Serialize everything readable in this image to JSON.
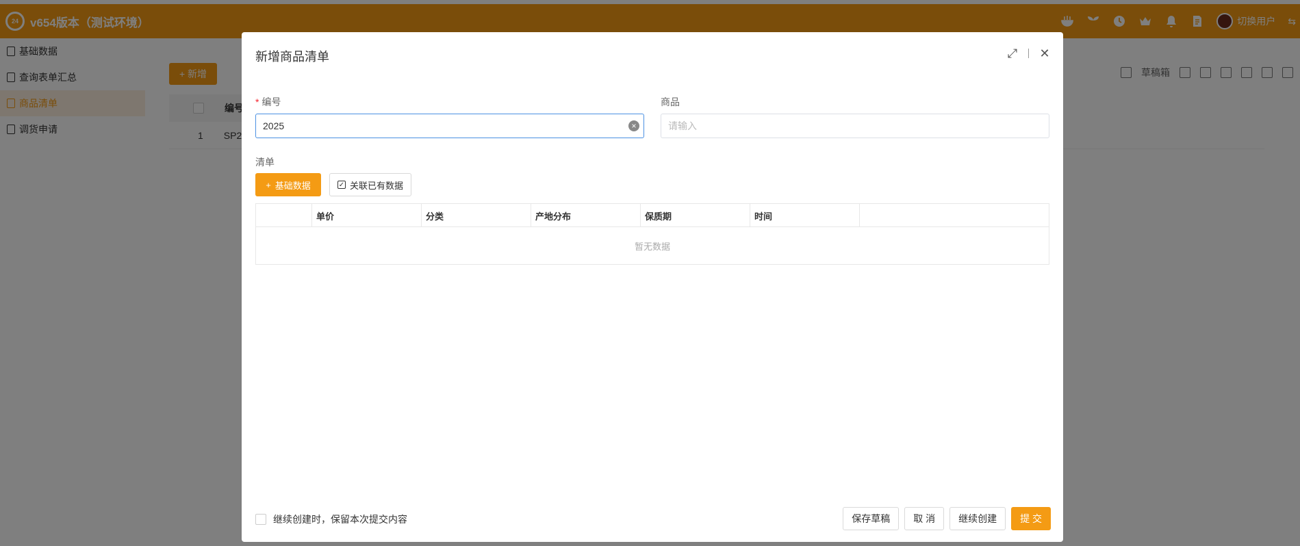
{
  "app": {
    "title": "v654版本（测试环境）",
    "logo_text": "24",
    "user_name": "切换用户",
    "arrow": "⇆"
  },
  "colors": {
    "accent": "#f49b14",
    "danger": "#f5222d",
    "focus": "#4a90e2"
  },
  "top_icons": [
    "noodle-icon",
    "sprout-icon",
    "clock-icon",
    "crown-icon",
    "bell-icon",
    "document-icon"
  ],
  "sidebar": {
    "items": [
      {
        "label": "基础数据",
        "active": false
      },
      {
        "label": "查询表单汇总",
        "active": false
      },
      {
        "label": "商品清单",
        "active": true
      },
      {
        "label": "调货申请",
        "active": false
      }
    ]
  },
  "main": {
    "new_button": "+ 新增",
    "draft_label": "草稿箱",
    "grid_header_code": "编号",
    "row_index": "1",
    "row_code_partial": "SP2"
  },
  "modal": {
    "title": "新增商品清单",
    "expand_icon": "⤢",
    "close_icon": "✕",
    "code_label": "编号",
    "code_required": "*",
    "code_value": "2025",
    "product_label": "商品",
    "product_placeholder": "请输入",
    "list_label": "清单",
    "base_data_button": "基础数据",
    "base_data_plus": "+",
    "link_existing_button": "关联已有数据",
    "link_check": "✓",
    "table_columns": [
      "",
      "单价",
      "分类",
      "产地分布",
      "保质期",
      "时间",
      ""
    ],
    "empty_text": "暂无数据",
    "keep_content_label": "继续创建时，保留本次提交内容",
    "save_draft": "保存草稿",
    "cancel": "取 消",
    "continue_create": "继续创建",
    "submit": "提 交"
  }
}
